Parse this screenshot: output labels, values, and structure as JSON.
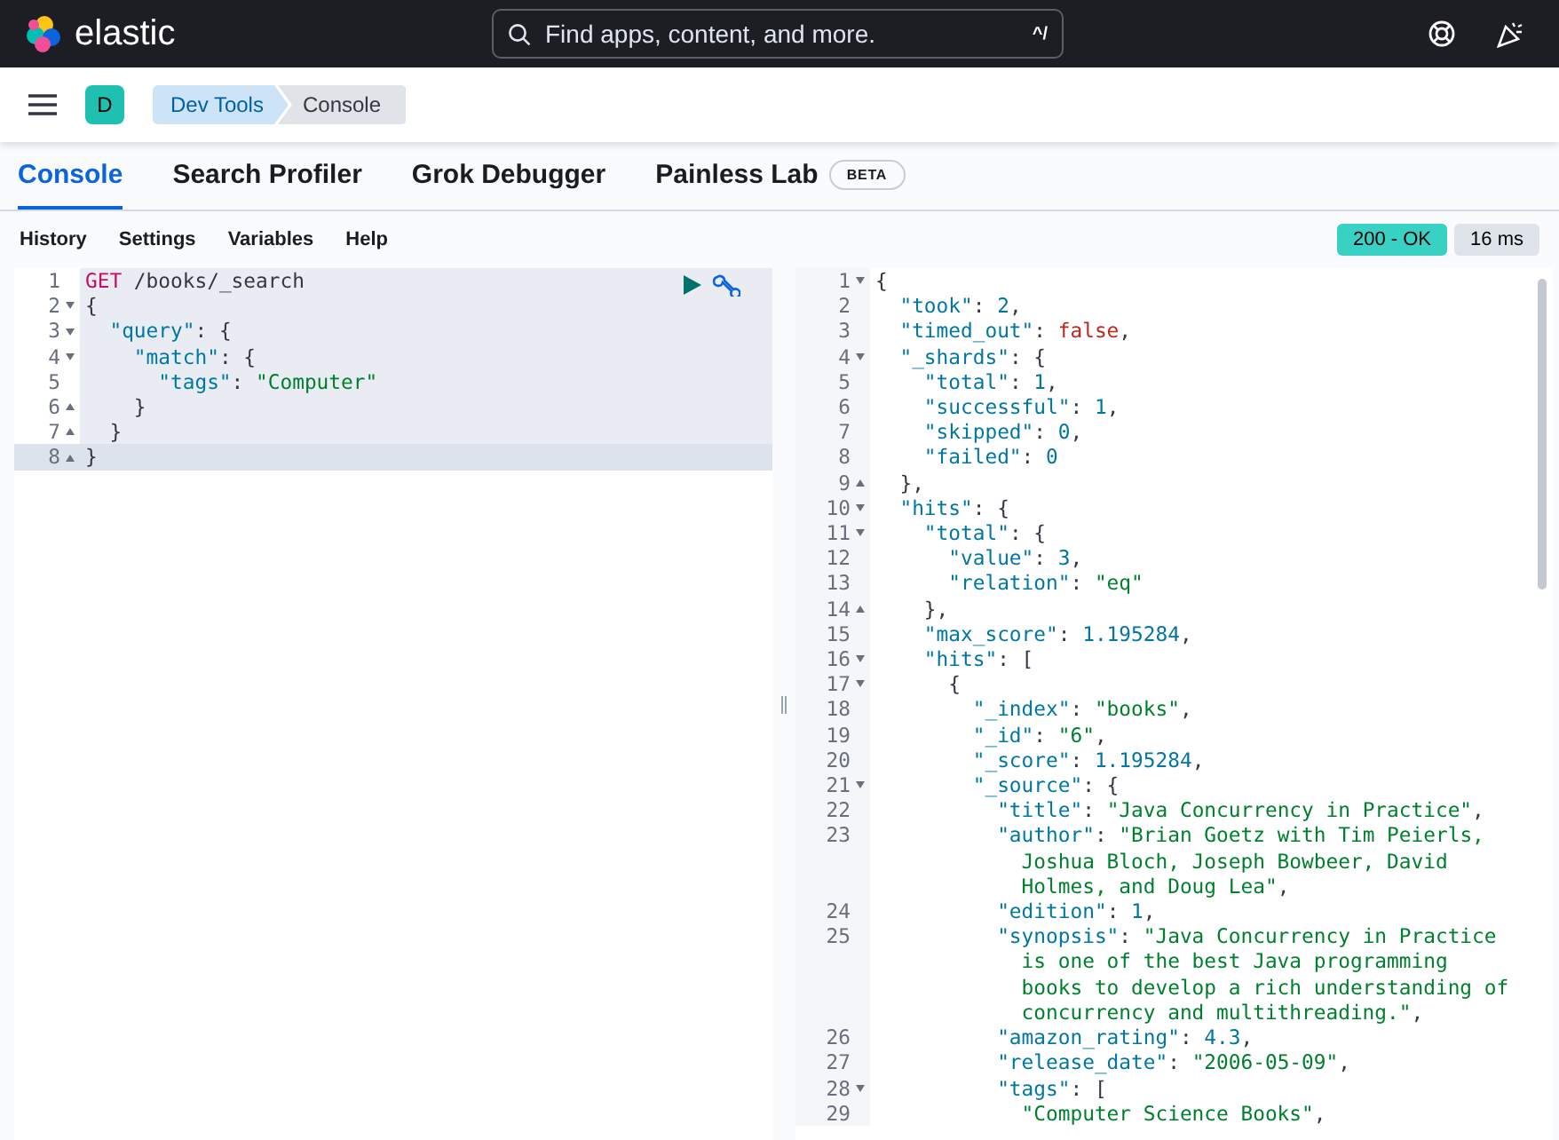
{
  "header": {
    "brand": "elastic",
    "search": {
      "placeholder": "Find apps, content, and more.",
      "shortcut": "^/"
    }
  },
  "breadcrumbs": {
    "space": "D",
    "items": [
      {
        "label": "Dev Tools",
        "selected": false
      },
      {
        "label": "Console",
        "selected": true
      }
    ]
  },
  "tabs": [
    {
      "label": "Console",
      "selected": true
    },
    {
      "label": "Search Profiler",
      "selected": false
    },
    {
      "label": "Grok Debugger",
      "selected": false
    },
    {
      "label": "Painless Lab",
      "selected": false,
      "badge": "BETA"
    }
  ],
  "toolbar": {
    "items": [
      "History",
      "Settings",
      "Variables",
      "Help"
    ],
    "status": "200 - OK",
    "time": "16 ms"
  },
  "request": [
    {
      "n": "1",
      "current": false,
      "tokens": [
        {
          "kind": "method",
          "t": "GET"
        },
        {
          "kind": "url",
          "t": " /books/_search"
        }
      ]
    },
    {
      "n": "2",
      "foldable": true,
      "expanded": true,
      "current": false,
      "tokens": [
        {
          "kind": "punct",
          "t": "{"
        }
      ]
    },
    {
      "n": "3",
      "foldable": true,
      "expanded": true,
      "current": false,
      "tokens": [
        {
          "kind": "key",
          "t": "  \"query\""
        },
        {
          "kind": "punct",
          "t": ": {"
        }
      ]
    },
    {
      "n": "4",
      "foldable": true,
      "expanded": true,
      "current": false,
      "tokens": [
        {
          "kind": "key",
          "t": "    \"match\""
        },
        {
          "kind": "punct",
          "t": ": {"
        }
      ]
    },
    {
      "n": "5",
      "current": false,
      "tokens": [
        {
          "kind": "key",
          "t": "      \"tags\""
        },
        {
          "kind": "punct",
          "t": ": "
        },
        {
          "kind": "string",
          "t": "\"Computer\""
        }
      ]
    },
    {
      "n": "6",
      "foldable": true,
      "expanded": false,
      "current": false,
      "tokens": [
        {
          "kind": "punct",
          "t": "    }"
        }
      ]
    },
    {
      "n": "7",
      "foldable": true,
      "expanded": false,
      "current": false,
      "tokens": [
        {
          "kind": "punct",
          "t": "  }"
        }
      ]
    },
    {
      "n": "8",
      "foldable": true,
      "expanded": false,
      "current": true,
      "tokens": [
        {
          "kind": "punct",
          "t": "}"
        }
      ]
    }
  ],
  "response": [
    {
      "n": "1",
      "foldable": true,
      "expanded": true,
      "tokens": [
        {
          "kind": "punct",
          "t": "{"
        }
      ]
    },
    {
      "n": "2",
      "tokens": [
        {
          "kind": "key",
          "t": "  \"took\""
        },
        {
          "kind": "punct",
          "t": ": "
        },
        {
          "kind": "number",
          "t": "2"
        },
        {
          "kind": "punct",
          "t": ","
        }
      ]
    },
    {
      "n": "3",
      "tokens": [
        {
          "kind": "key",
          "t": "  \"timed_out\""
        },
        {
          "kind": "punct",
          "t": ": "
        },
        {
          "kind": "bool",
          "t": "false"
        },
        {
          "kind": "punct",
          "t": ","
        }
      ]
    },
    {
      "n": "4",
      "foldable": true,
      "expanded": true,
      "tokens": [
        {
          "kind": "key",
          "t": "  \"_shards\""
        },
        {
          "kind": "punct",
          "t": ": {"
        }
      ]
    },
    {
      "n": "5",
      "tokens": [
        {
          "kind": "key",
          "t": "    \"total\""
        },
        {
          "kind": "punct",
          "t": ": "
        },
        {
          "kind": "number",
          "t": "1"
        },
        {
          "kind": "punct",
          "t": ","
        }
      ]
    },
    {
      "n": "6",
      "tokens": [
        {
          "kind": "key",
          "t": "    \"successful\""
        },
        {
          "kind": "punct",
          "t": ": "
        },
        {
          "kind": "number",
          "t": "1"
        },
        {
          "kind": "punct",
          "t": ","
        }
      ]
    },
    {
      "n": "7",
      "tokens": [
        {
          "kind": "key",
          "t": "    \"skipped\""
        },
        {
          "kind": "punct",
          "t": ": "
        },
        {
          "kind": "number",
          "t": "0"
        },
        {
          "kind": "punct",
          "t": ","
        }
      ]
    },
    {
      "n": "8",
      "tokens": [
        {
          "kind": "key",
          "t": "    \"failed\""
        },
        {
          "kind": "punct",
          "t": ": "
        },
        {
          "kind": "number",
          "t": "0"
        }
      ]
    },
    {
      "n": "9",
      "foldable": true,
      "expanded": false,
      "tokens": [
        {
          "kind": "punct",
          "t": "  },"
        }
      ]
    },
    {
      "n": "10",
      "foldable": true,
      "expanded": true,
      "tokens": [
        {
          "kind": "key",
          "t": "  \"hits\""
        },
        {
          "kind": "punct",
          "t": ": {"
        }
      ]
    },
    {
      "n": "11",
      "foldable": true,
      "expanded": true,
      "tokens": [
        {
          "kind": "key",
          "t": "    \"total\""
        },
        {
          "kind": "punct",
          "t": ": {"
        }
      ]
    },
    {
      "n": "12",
      "tokens": [
        {
          "kind": "key",
          "t": "      \"value\""
        },
        {
          "kind": "punct",
          "t": ": "
        },
        {
          "kind": "number",
          "t": "3"
        },
        {
          "kind": "punct",
          "t": ","
        }
      ]
    },
    {
      "n": "13",
      "tokens": [
        {
          "kind": "key",
          "t": "      \"relation\""
        },
        {
          "kind": "punct",
          "t": ": "
        },
        {
          "kind": "string",
          "t": "\"eq\""
        }
      ]
    },
    {
      "n": "14",
      "foldable": true,
      "expanded": false,
      "tokens": [
        {
          "kind": "punct",
          "t": "    },"
        }
      ]
    },
    {
      "n": "15",
      "tokens": [
        {
          "kind": "key",
          "t": "    \"max_score\""
        },
        {
          "kind": "punct",
          "t": ": "
        },
        {
          "kind": "number",
          "t": "1.195284"
        },
        {
          "kind": "punct",
          "t": ","
        }
      ]
    },
    {
      "n": "16",
      "foldable": true,
      "expanded": true,
      "tokens": [
        {
          "kind": "key",
          "t": "    \"hits\""
        },
        {
          "kind": "punct",
          "t": ": ["
        }
      ]
    },
    {
      "n": "17",
      "foldable": true,
      "expanded": true,
      "tokens": [
        {
          "kind": "punct",
          "t": "      {"
        }
      ]
    },
    {
      "n": "18",
      "tokens": [
        {
          "kind": "key",
          "t": "        \"_index\""
        },
        {
          "kind": "punct",
          "t": ": "
        },
        {
          "kind": "string",
          "t": "\"books\""
        },
        {
          "kind": "punct",
          "t": ","
        }
      ]
    },
    {
      "n": "19",
      "tokens": [
        {
          "kind": "key",
          "t": "        \"_id\""
        },
        {
          "kind": "punct",
          "t": ": "
        },
        {
          "kind": "string",
          "t": "\"6\""
        },
        {
          "kind": "punct",
          "t": ","
        }
      ]
    },
    {
      "n": "20",
      "tokens": [
        {
          "kind": "key",
          "t": "        \"_score\""
        },
        {
          "kind": "punct",
          "t": ": "
        },
        {
          "kind": "number",
          "t": "1.195284"
        },
        {
          "kind": "punct",
          "t": ","
        }
      ]
    },
    {
      "n": "21",
      "foldable": true,
      "expanded": true,
      "tokens": [
        {
          "kind": "key",
          "t": "        \"_source\""
        },
        {
          "kind": "punct",
          "t": ": {"
        }
      ]
    },
    {
      "n": "22",
      "tokens": [
        {
          "kind": "key",
          "t": "          \"title\""
        },
        {
          "kind": "punct",
          "t": ": "
        },
        {
          "kind": "string",
          "t": "\"Java Concurrency in Practice\""
        },
        {
          "kind": "punct",
          "t": ","
        }
      ]
    },
    {
      "n": "23",
      "tokens": [
        {
          "kind": "key",
          "t": "          \"author\""
        },
        {
          "kind": "punct",
          "t": ": "
        },
        {
          "kind": "string",
          "t": "\"Brian Goetz with Tim Peierls,"
        }
      ],
      "wrapped": [
        [
          {
            "kind": "string",
            "t": "            Joshua Bloch, Joseph Bowbeer, David"
          }
        ],
        [
          {
            "kind": "string",
            "t": "            Holmes, and Doug Lea\""
          },
          {
            "kind": "punct",
            "t": ","
          }
        ]
      ]
    },
    {
      "n": "24",
      "tokens": [
        {
          "kind": "key",
          "t": "          \"edition\""
        },
        {
          "kind": "punct",
          "t": ": "
        },
        {
          "kind": "number",
          "t": "1"
        },
        {
          "kind": "punct",
          "t": ","
        }
      ]
    },
    {
      "n": "25",
      "tokens": [
        {
          "kind": "key",
          "t": "          \"synopsis\""
        },
        {
          "kind": "punct",
          "t": ": "
        },
        {
          "kind": "string",
          "t": "\"Java Concurrency in Practice"
        }
      ],
      "wrapped": [
        [
          {
            "kind": "string",
            "t": "            is one of the best Java programming"
          }
        ],
        [
          {
            "kind": "string",
            "t": "            books to develop a rich understanding of"
          }
        ],
        [
          {
            "kind": "string",
            "t": "            concurrency and multithreading.\""
          },
          {
            "kind": "punct",
            "t": ","
          }
        ]
      ]
    },
    {
      "n": "26",
      "tokens": [
        {
          "kind": "key",
          "t": "          \"amazon_rating\""
        },
        {
          "kind": "punct",
          "t": ": "
        },
        {
          "kind": "number",
          "t": "4.3"
        },
        {
          "kind": "punct",
          "t": ","
        }
      ]
    },
    {
      "n": "27",
      "tokens": [
        {
          "kind": "key",
          "t": "          \"release_date\""
        },
        {
          "kind": "punct",
          "t": ": "
        },
        {
          "kind": "string",
          "t": "\"2006-05-09\""
        },
        {
          "kind": "punct",
          "t": ","
        }
      ]
    },
    {
      "n": "28",
      "foldable": true,
      "expanded": true,
      "tokens": [
        {
          "kind": "key",
          "t": "          \"tags\""
        },
        {
          "kind": "punct",
          "t": ": ["
        }
      ]
    },
    {
      "n": "29",
      "tokens": [
        {
          "kind": "string",
          "t": "            \"Computer Science Books\""
        },
        {
          "kind": "punct",
          "t": ","
        }
      ]
    }
  ]
}
